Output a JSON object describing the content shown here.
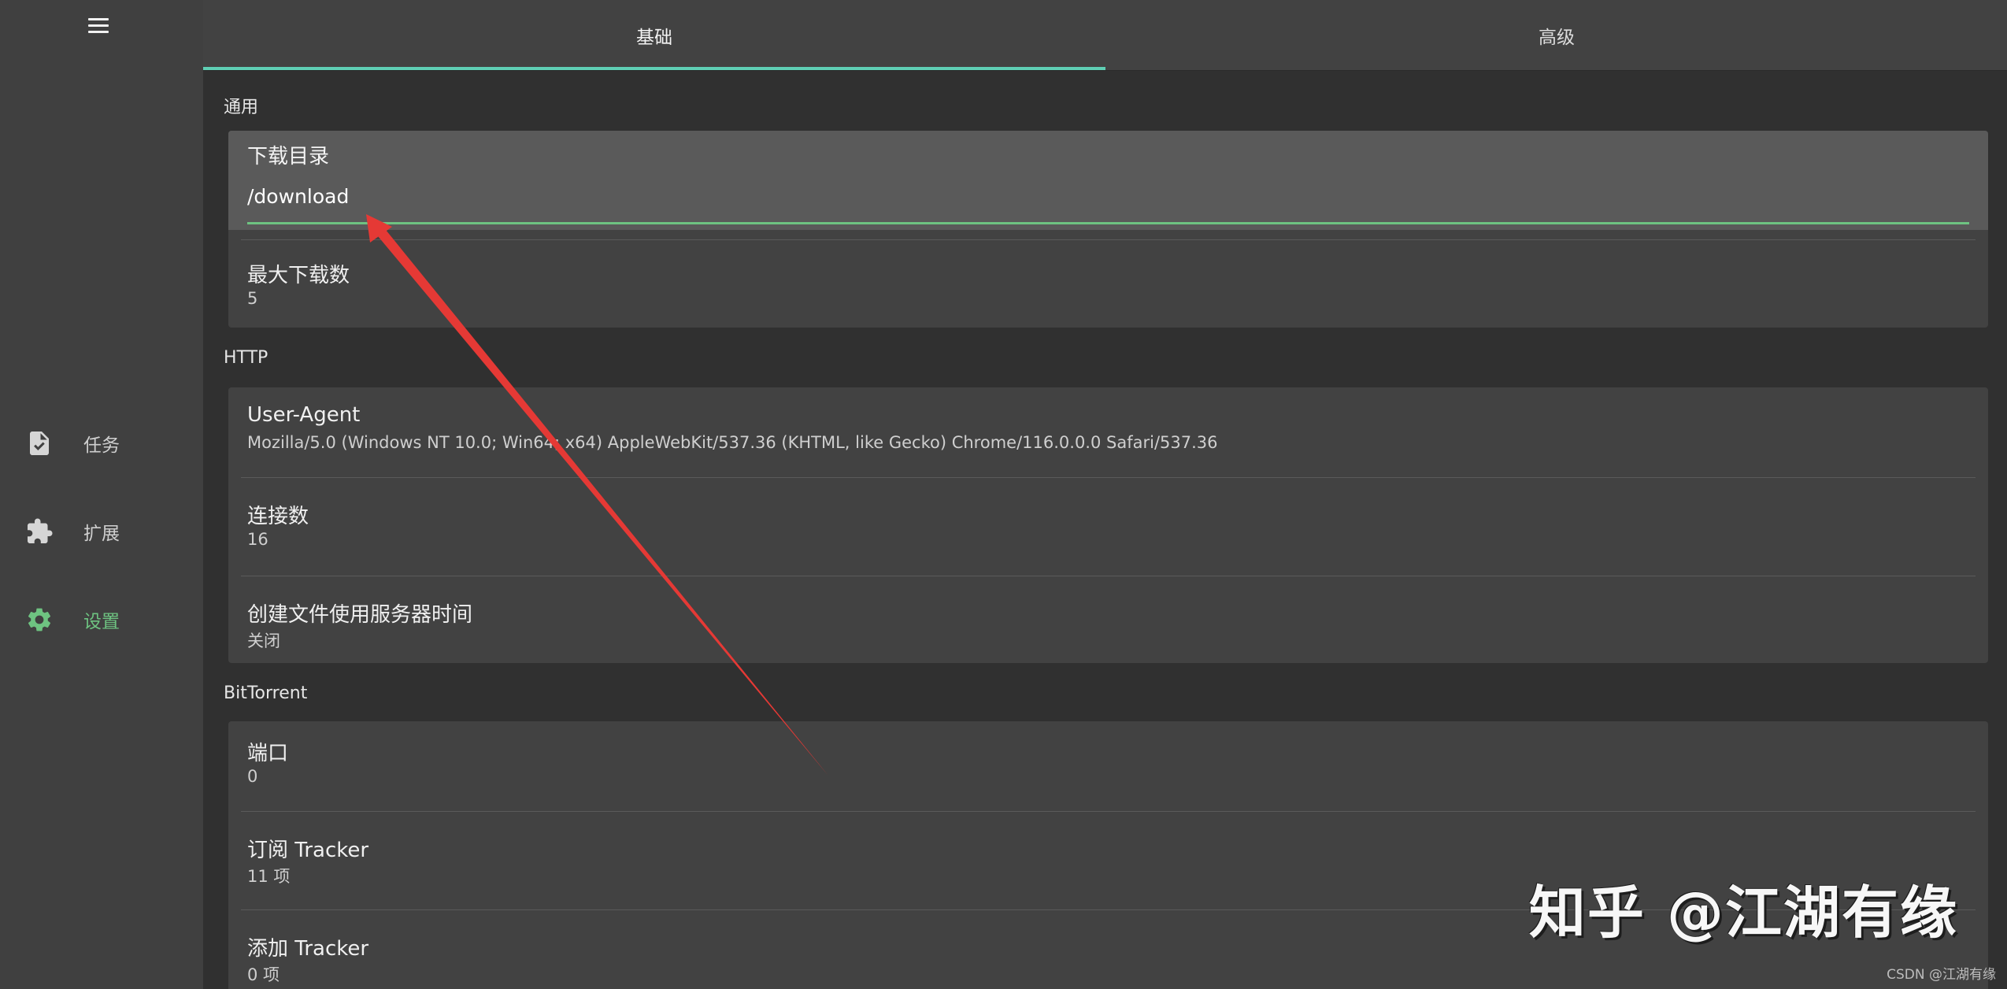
{
  "sidebar": {
    "items": [
      {
        "label": "任务",
        "icon": "task-document-icon",
        "active": false
      },
      {
        "label": "扩展",
        "icon": "puzzle-icon",
        "active": false
      },
      {
        "label": "设置",
        "icon": "gear-icon",
        "active": true
      }
    ]
  },
  "tabs": [
    {
      "label": "基础",
      "active": true
    },
    {
      "label": "高级",
      "active": false
    }
  ],
  "sections": {
    "general": {
      "title": "通用",
      "download_dir": {
        "label": "下载目录",
        "value": "/download"
      },
      "max_downloads": {
        "label": "最大下载数",
        "value": "5"
      }
    },
    "http": {
      "title": "HTTP",
      "user_agent": {
        "label": "User-Agent",
        "value": "Mozilla/5.0 (Windows NT 10.0; Win64; x64) AppleWebKit/537.36 (KHTML, like Gecko) Chrome/116.0.0.0 Safari/537.36"
      },
      "connections": {
        "label": "连接数",
        "value": "16"
      },
      "server_time": {
        "label": "创建文件使用服务器时间",
        "value": "关闭"
      }
    },
    "bittorrent": {
      "title": "BitTorrent",
      "port": {
        "label": "端口",
        "value": "0"
      },
      "subscribe_tracker": {
        "label": "订阅 Tracker",
        "value": "11 项"
      },
      "add_tracker": {
        "label": "添加 Tracker",
        "value": "0 项"
      }
    }
  },
  "watermark": {
    "main": "知乎 @江湖有缘",
    "small": "CSDN @江湖有缘"
  },
  "colors": {
    "accent_green": "#6ec381",
    "tab_indicator": "#5fcfb4",
    "arrow": "#e53935"
  }
}
